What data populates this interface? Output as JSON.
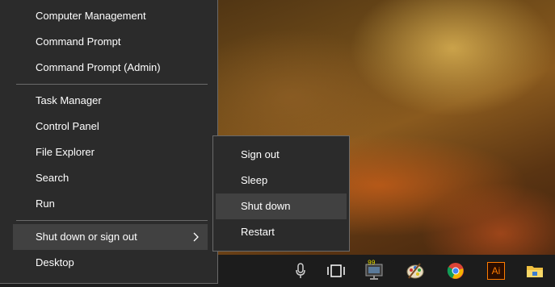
{
  "winx_menu": {
    "group1": [
      "Computer Management",
      "Command Prompt",
      "Command Prompt (Admin)"
    ],
    "group2": [
      "Task Manager",
      "Control Panel",
      "File Explorer",
      "Search",
      "Run"
    ],
    "shutdown_label": "Shut down or sign out",
    "desktop_label": "Desktop"
  },
  "power_submenu": {
    "items": [
      "Sign out",
      "Sleep",
      "Shut down",
      "Restart"
    ],
    "highlighted": "Shut down"
  },
  "taskbar": {
    "icons": [
      "microphone-icon",
      "task-view-icon",
      "monitor-app-icon",
      "paint-palette-icon",
      "chrome-icon",
      "illustrator-icon",
      "file-explorer-icon"
    ],
    "monitor_badge": "99",
    "illustrator_text": "Ai"
  },
  "colors": {
    "menu_bg": "#2b2b2b",
    "menu_highlight": "#414141",
    "menu_border": "#6a6a6a",
    "taskbar_bg": "#1c1c1c",
    "illustrator_orange": "#ff7c00"
  }
}
